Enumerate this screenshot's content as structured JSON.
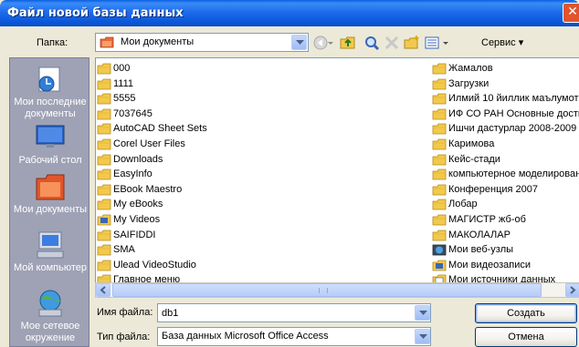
{
  "window": {
    "title": "Файл новой базы данных",
    "close_glyph": "✕"
  },
  "toolbar": {
    "folder_label": "Папка:",
    "location": "Мои документы",
    "service_label": "Сервис ▾",
    "icons": [
      "back-icon",
      "up-folder-icon",
      "search-web-icon",
      "delete-icon",
      "new-folder-icon",
      "views-icon"
    ]
  },
  "places": [
    {
      "label": "Мои последние документы",
      "icon": "recent-documents-icon"
    },
    {
      "label": "Рабочий стол",
      "icon": "desktop-icon"
    },
    {
      "label": "Мои документы",
      "icon": "my-documents-icon"
    },
    {
      "label": "Мой компьютер",
      "icon": "my-computer-icon"
    },
    {
      "label": "Мое сетевое окружение",
      "icon": "network-places-icon"
    }
  ],
  "files_left": [
    {
      "name": "000",
      "icon": "folder"
    },
    {
      "name": "1111",
      "icon": "folder"
    },
    {
      "name": "5555",
      "icon": "folder"
    },
    {
      "name": "7037645",
      "icon": "folder"
    },
    {
      "name": "AutoCAD Sheet Sets",
      "icon": "folder"
    },
    {
      "name": "Corel User Files",
      "icon": "folder"
    },
    {
      "name": "Downloads",
      "icon": "folder"
    },
    {
      "name": "EasyInfo",
      "icon": "folder"
    },
    {
      "name": "EBook Maestro",
      "icon": "folder"
    },
    {
      "name": "My eBooks",
      "icon": "folder"
    },
    {
      "name": "My Videos",
      "icon": "video-folder"
    },
    {
      "name": "SAIFIDDI",
      "icon": "folder"
    },
    {
      "name": "SMA",
      "icon": "folder"
    },
    {
      "name": "Ulead VideoStudio",
      "icon": "folder"
    },
    {
      "name": "Главное меню",
      "icon": "folder"
    }
  ],
  "files_right": [
    {
      "name": "Жамалов",
      "icon": "folder"
    },
    {
      "name": "Загрузки",
      "icon": "folder"
    },
    {
      "name": "Илмий 10 йиллик маълумот",
      "icon": "folder"
    },
    {
      "name": "ИФ СО РАН  Основные достиж",
      "icon": "folder"
    },
    {
      "name": "Ишчи дастурлар 2008-2009",
      "icon": "folder"
    },
    {
      "name": "Каримова",
      "icon": "folder"
    },
    {
      "name": "Кейс-стади",
      "icon": "folder"
    },
    {
      "name": "компьютерное моделирован",
      "icon": "folder"
    },
    {
      "name": "Конференция 2007",
      "icon": "folder"
    },
    {
      "name": "Лобар",
      "icon": "folder"
    },
    {
      "name": "МАГИСТР жб-об",
      "icon": "folder"
    },
    {
      "name": "МАКОЛАЛАР",
      "icon": "folder"
    },
    {
      "name": "Мои веб-узлы",
      "icon": "web-folder"
    },
    {
      "name": "Мои видеозаписи",
      "icon": "video-folder"
    },
    {
      "name": "Мои источники данных",
      "icon": "data-sources-folder"
    }
  ],
  "scrollbar": {
    "left_arrow": "◀",
    "right_arrow": "▶"
  },
  "form": {
    "filename_label": "Имя файла:",
    "filename_value": "db1",
    "filetype_label": "Тип файла:",
    "filetype_value": "База данных Microsoft Office Access",
    "create_button": "Создать",
    "cancel_button": "Отмена"
  },
  "colors": {
    "titlebar": "#0b55d8",
    "places_bg": "#9fa2b5",
    "dialog_bg": "#ece9d8",
    "folder": "#f2c94c"
  }
}
